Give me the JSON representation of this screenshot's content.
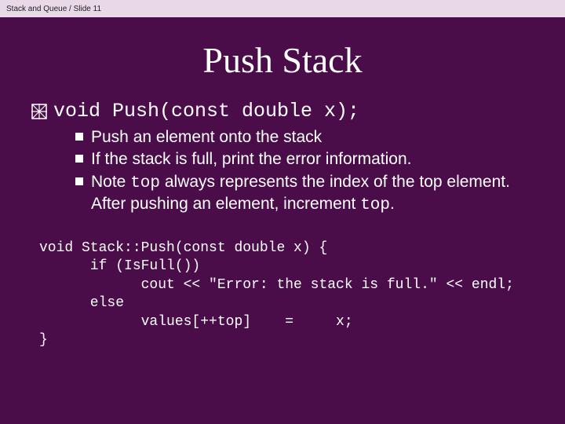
{
  "breadcrumb": "Stack and Queue / Slide 11",
  "title": "Push Stack",
  "main_signature": "void Push(const double x);",
  "bullets": {
    "b0": "Push an element onto the stack",
    "b1": "If the stack is full, print the error information.",
    "b2_pre": "Note ",
    "b2_code1": "top",
    "b2_mid": " always represents the index of the top element. After pushing an element, increment ",
    "b2_code2": "top",
    "b2_post": "."
  },
  "code": {
    "l0": "void Stack::Push(const double x) {",
    "l1": "      if (IsFull())",
    "l2": "            cout << \"Error: the stack is full.\" << endl;",
    "l3": "      else",
    "l4": "            values[++top]    =     x;",
    "l5": "}"
  }
}
